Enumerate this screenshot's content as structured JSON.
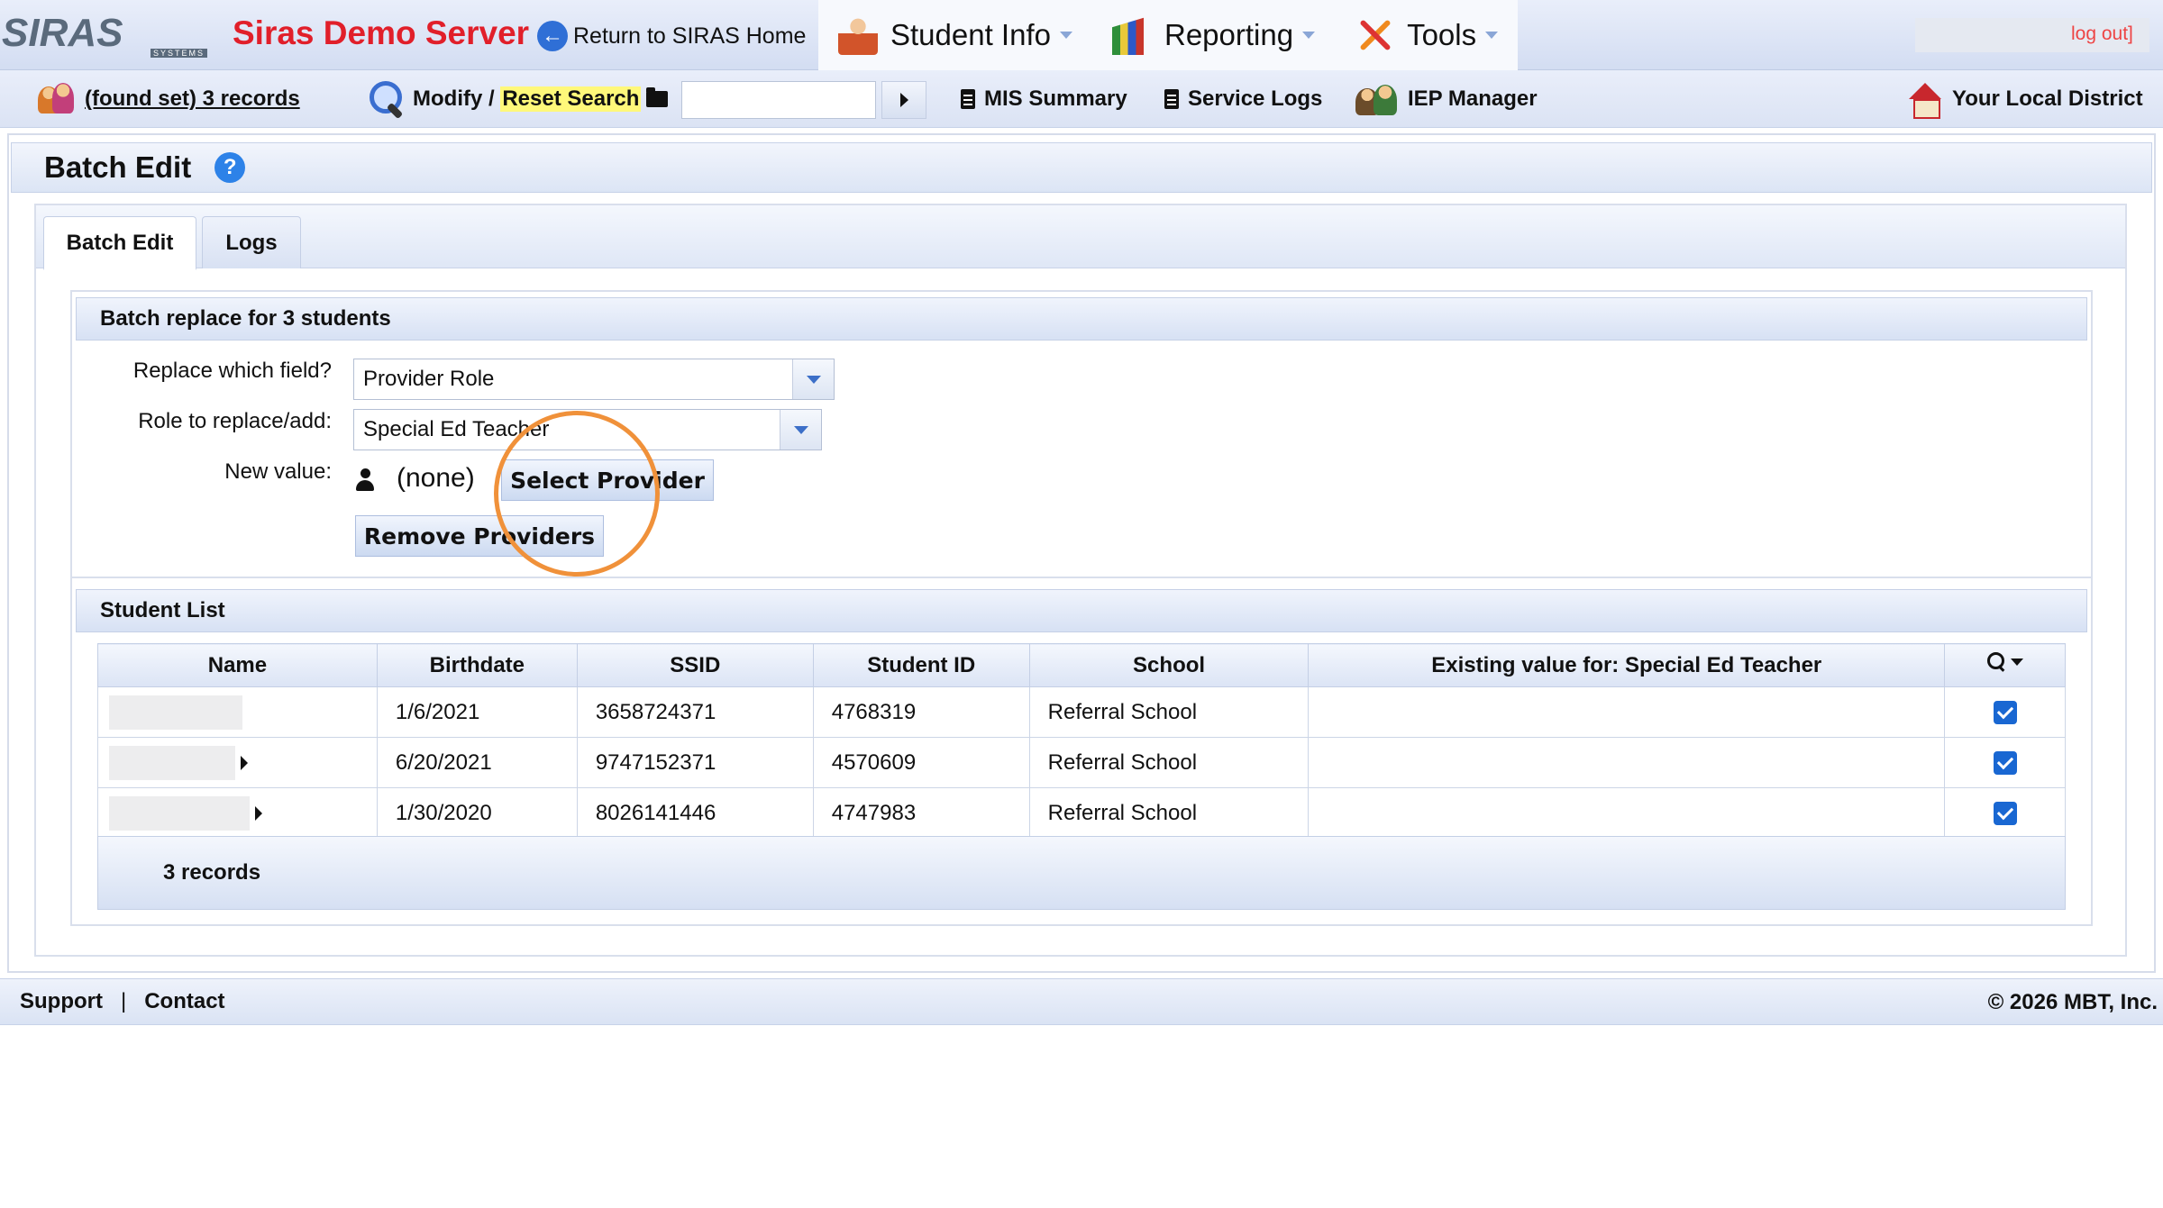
{
  "header": {
    "logo_text": "SIRAS",
    "logo_sub": "SYSTEMS",
    "server_name": "Siras Demo Server",
    "return_label": "Return to SIRAS Home",
    "menu": [
      {
        "label": "Student Info",
        "icon": "student-icon"
      },
      {
        "label": "Reporting",
        "icon": "report-icon"
      },
      {
        "label": "Tools",
        "icon": "tools-icon"
      }
    ],
    "logout_label": "log out]"
  },
  "toolbar": {
    "found_set_label": "(found set) 3 records",
    "modify_label": "Modify /",
    "reset_label": "Reset Search",
    "quick_search_value": "",
    "mis_summary": "MIS Summary",
    "service_logs": "Service Logs",
    "iep_manager": "IEP Manager",
    "district": "Your Local District"
  },
  "page": {
    "title": "Batch Edit",
    "help": "?",
    "tabs": [
      {
        "label": "Batch Edit",
        "active": true
      },
      {
        "label": "Logs",
        "active": false
      }
    ]
  },
  "batch": {
    "section_title": "Batch replace for 3 students",
    "field_label": "Replace which field?",
    "field_value": "Provider Role",
    "role_label": "Role to replace/add:",
    "role_value": "Special Ed Teacher",
    "new_value_label": "New value:",
    "new_value": "(none)",
    "select_provider_button": "Select Provider",
    "remove_providers_button": "Remove Providers"
  },
  "student_list": {
    "section_title": "Student List",
    "columns": [
      "Name",
      "Birthdate",
      "SSID",
      "Student ID",
      "School",
      "Existing value for: Special Ed Teacher"
    ],
    "rows": [
      {
        "birthdate": "1/6/2021",
        "ssid": "3658724371",
        "student_id": "4768319",
        "school": "Referral School",
        "existing": "",
        "checked": true
      },
      {
        "birthdate": "6/20/2021",
        "ssid": "9747152371",
        "student_id": "4570609",
        "school": "Referral School",
        "existing": "",
        "checked": true
      },
      {
        "birthdate": "1/30/2020",
        "ssid": "8026141446",
        "student_id": "4747983",
        "school": "Referral School",
        "existing": "",
        "checked": true
      }
    ],
    "footer_count": "3 records"
  },
  "footer": {
    "support": "Support",
    "separator": "|",
    "contact": "Contact",
    "copyright": "© 2026 MBT, Inc."
  },
  "colors": {
    "server_name": "#e11f2a",
    "accent_blue": "#2d82e8",
    "checkbox": "#1967d2",
    "highlight_ring": "#f0913a"
  }
}
